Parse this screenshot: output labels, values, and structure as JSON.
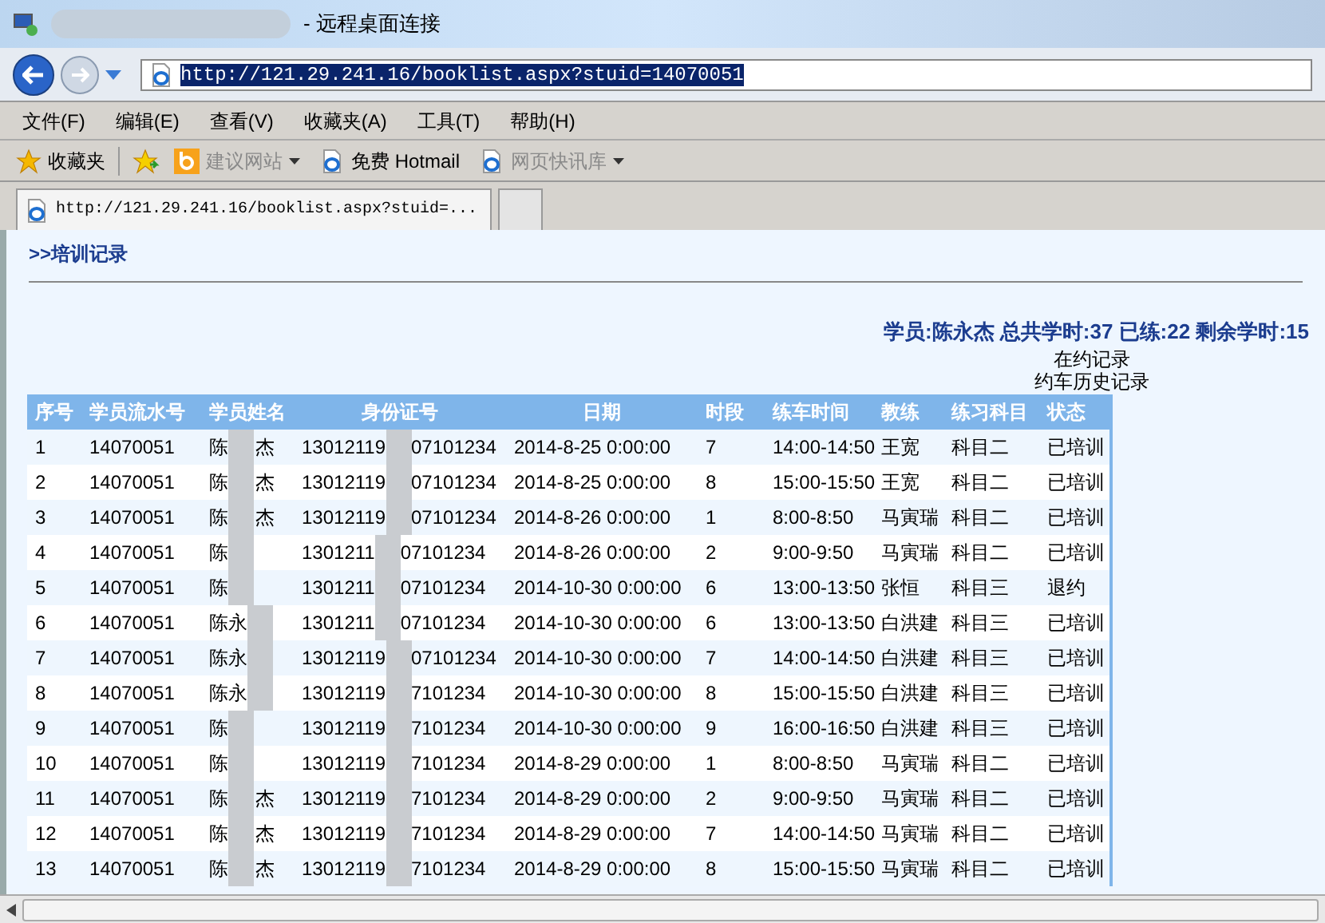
{
  "window": {
    "title": "- 远程桌面连接"
  },
  "browser": {
    "address": "http://121.29.241.16/booklist.aspx?stuid=14070051",
    "menu": [
      "文件(F)",
      "编辑(E)",
      "查看(V)",
      "收藏夹(A)",
      "工具(T)",
      "帮助(H)"
    ],
    "favorites": {
      "label": "收藏夹",
      "items": [
        {
          "kind": "bing",
          "label": "建议网站",
          "disabled": true,
          "dropdown": true
        },
        {
          "kind": "ie",
          "label": "免费 Hotmail",
          "disabled": false,
          "dropdown": false
        },
        {
          "kind": "ie",
          "label": "网页快讯库",
          "disabled": true,
          "dropdown": true
        }
      ]
    },
    "tab": {
      "label": "http://121.29.241.16/booklist.aspx?stuid=..."
    }
  },
  "page": {
    "heading": ">>培训记录",
    "summary": "学员:陈永杰 总共学时:37 已练:22 剩余学时:15",
    "links": [
      "在约记录",
      "约车历史记录"
    ],
    "table": {
      "columns": [
        "序号",
        "学员流水号",
        "学员姓名",
        "身份证号",
        "日期",
        "时段",
        "练车时间",
        "教练",
        "练习科目",
        "状态"
      ],
      "rows": [
        {
          "no": "1",
          "serial": "14070051",
          "name_start": "陈",
          "name_end": "杰",
          "id_start": "13012119",
          "id_end": "07101234",
          "date": "2014-8-25 0:00:00",
          "slot": "7",
          "time": "14:00-14:50",
          "coach": "王宽",
          "subject": "科目二",
          "status": "已培训"
        },
        {
          "no": "2",
          "serial": "14070051",
          "name_start": "陈",
          "name_end": "杰",
          "id_start": "13012119",
          "id_end": "07101234",
          "date": "2014-8-25 0:00:00",
          "slot": "8",
          "time": "15:00-15:50",
          "coach": "王宽",
          "subject": "科目二",
          "status": "已培训"
        },
        {
          "no": "3",
          "serial": "14070051",
          "name_start": "陈",
          "name_end": "杰",
          "id_start": "13012119",
          "id_end": "07101234",
          "date": "2014-8-26 0:00:00",
          "slot": "1",
          "time": "8:00-8:50",
          "coach": "马寅瑞",
          "subject": "科目二",
          "status": "已培训"
        },
        {
          "no": "4",
          "serial": "14070051",
          "name_start": "陈",
          "id_start": "1301211",
          "id_end": "07101234",
          "date": "2014-8-26 0:00:00",
          "slot": "2",
          "time": "9:00-9:50",
          "coach": "马寅瑞",
          "subject": "科目二",
          "status": "已培训"
        },
        {
          "no": "5",
          "serial": "14070051",
          "name_start": "陈",
          "id_start": "1301211",
          "id_end": "07101234",
          "date": "2014-10-30 0:00:00",
          "slot": "6",
          "time": "13:00-13:50",
          "coach": "张恒",
          "subject": "科目三",
          "status": "退约"
        },
        {
          "no": "6",
          "serial": "14070051",
          "name_start": "陈永",
          "id_start": "1301211",
          "id_end": "07101234",
          "date": "2014-10-30 0:00:00",
          "slot": "6",
          "time": "13:00-13:50",
          "coach": "白洪建",
          "subject": "科目三",
          "status": "已培训"
        },
        {
          "no": "7",
          "serial": "14070051",
          "name_start": "陈永",
          "id_start": "13012119",
          "id_end": "07101234",
          "date": "2014-10-30 0:00:00",
          "slot": "7",
          "time": "14:00-14:50",
          "coach": "白洪建",
          "subject": "科目三",
          "status": "已培训"
        },
        {
          "no": "8",
          "serial": "14070051",
          "name_start": "陈永",
          "id_start": "13012119",
          "id_end": "7101234",
          "date": "2014-10-30 0:00:00",
          "slot": "8",
          "time": "15:00-15:50",
          "coach": "白洪建",
          "subject": "科目三",
          "status": "已培训"
        },
        {
          "no": "9",
          "serial": "14070051",
          "name_start": "陈",
          "id_start": "13012119",
          "id_end": "7101234",
          "date": "2014-10-30 0:00:00",
          "slot": "9",
          "time": "16:00-16:50",
          "coach": "白洪建",
          "subject": "科目三",
          "status": "已培训"
        },
        {
          "no": "10",
          "serial": "14070051",
          "name_start": "陈",
          "id_start": "13012119",
          "id_end": "7101234",
          "date": "2014-8-29 0:00:00",
          "slot": "1",
          "time": "8:00-8:50",
          "coach": "马寅瑞",
          "subject": "科目二",
          "status": "已培训"
        },
        {
          "no": "11",
          "serial": "14070051",
          "name_start": "陈",
          "name_end": "杰",
          "id_start": "13012119",
          "id_end": "7101234",
          "date": "2014-8-29 0:00:00",
          "slot": "2",
          "time": "9:00-9:50",
          "coach": "马寅瑞",
          "subject": "科目二",
          "status": "已培训"
        },
        {
          "no": "12",
          "serial": "14070051",
          "name_start": "陈",
          "name_end": "杰",
          "id_start": "13012119",
          "id_end": "7101234",
          "date": "2014-8-29 0:00:00",
          "slot": "7",
          "time": "14:00-14:50",
          "coach": "马寅瑞",
          "subject": "科目二",
          "status": "已培训"
        },
        {
          "no": "13",
          "serial": "14070051",
          "name_start": "陈",
          "name_end": "杰",
          "id_start": "13012119",
          "id_end": "7101234",
          "date": "2014-8-29 0:00:00",
          "slot": "8",
          "time": "15:00-15:50",
          "coach": "马寅瑞",
          "subject": "科目二",
          "status": "已培训"
        }
      ]
    }
  }
}
